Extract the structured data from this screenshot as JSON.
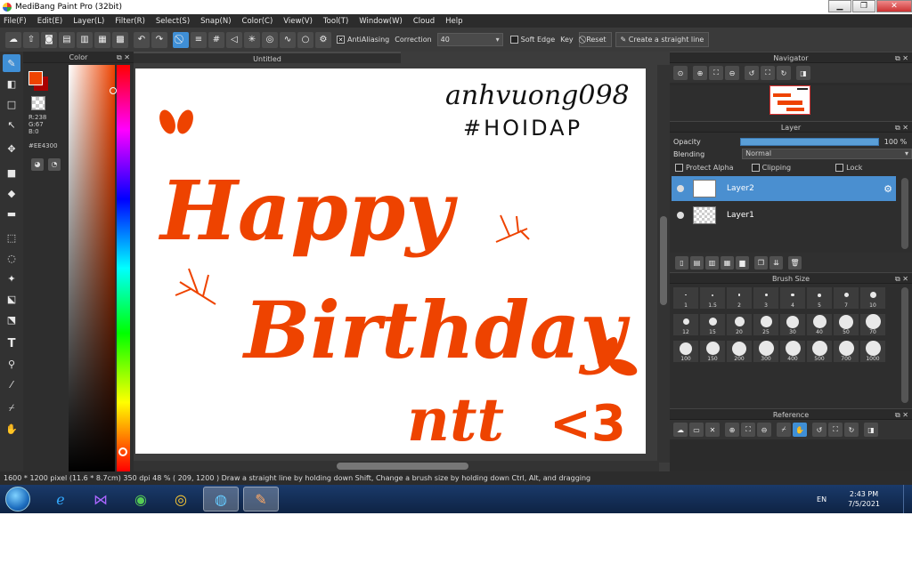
{
  "window": {
    "title": "MediBang Paint Pro (32bit)",
    "min": "▁",
    "max": "❐",
    "close": "✕"
  },
  "menu": [
    "File(F)",
    "Edit(E)",
    "Layer(L)",
    "Filter(R)",
    "Select(S)",
    "Snap(N)",
    "Color(C)",
    "View(V)",
    "Tool(T)",
    "Window(W)",
    "Cloud",
    "Help"
  ],
  "toolbar": {
    "antialiasing": "AntiAliasing",
    "correction_label": "Correction",
    "correction_value": "40",
    "soft_edge": "Soft Edge",
    "key_label": "Key",
    "reset": "Reset",
    "create_line": "Create a straight line"
  },
  "color_panel": {
    "title": "Color",
    "r": "R:238",
    "g": "G:67",
    "b": "B:0",
    "hex": "#EE4300",
    "fg_color": "#EE4300"
  },
  "canvas": {
    "tab": "Untitled",
    "handwriting_top": "anhvuong098",
    "hashtag": "#HOIDAP",
    "line1": "Happy",
    "line2": "Birthday",
    "line3": "ntt",
    "line3_tail": "<3",
    "ink_color": "#EE4300"
  },
  "navigator": {
    "title": "Navigator"
  },
  "layer": {
    "title": "Layer",
    "opacity_label": "Opacity",
    "opacity_value": "100 %",
    "opacity": 1.0,
    "blending_label": "Blending",
    "blending_value": "Normal",
    "protect_alpha": "Protect Alpha",
    "clipping": "Clipping",
    "lock": "Lock",
    "items": [
      {
        "name": "Layer2",
        "selected": true
      },
      {
        "name": "Layer1",
        "selected": false
      }
    ]
  },
  "brush_size": {
    "title": "Brush Size",
    "sizes": [
      "1",
      "1.5",
      "2",
      "3",
      "4",
      "5",
      "7",
      "10",
      "12",
      "15",
      "20",
      "25",
      "30",
      "40",
      "50",
      "70",
      "100",
      "150",
      "200",
      "300",
      "400",
      "500",
      "700",
      "1000"
    ]
  },
  "reference": {
    "title": "Reference"
  },
  "status": {
    "text": "1600 * 1200 pixel   (11.6 * 8.7cm)   350 dpi   48 %   ( 209, 1200 )   Draw a straight line by holding down Shift, Change a brush size by holding down Ctrl, Alt, and dragging"
  },
  "taskbar": {
    "lang": "EN",
    "time": "2:43 PM",
    "date": "7/5/2021"
  }
}
